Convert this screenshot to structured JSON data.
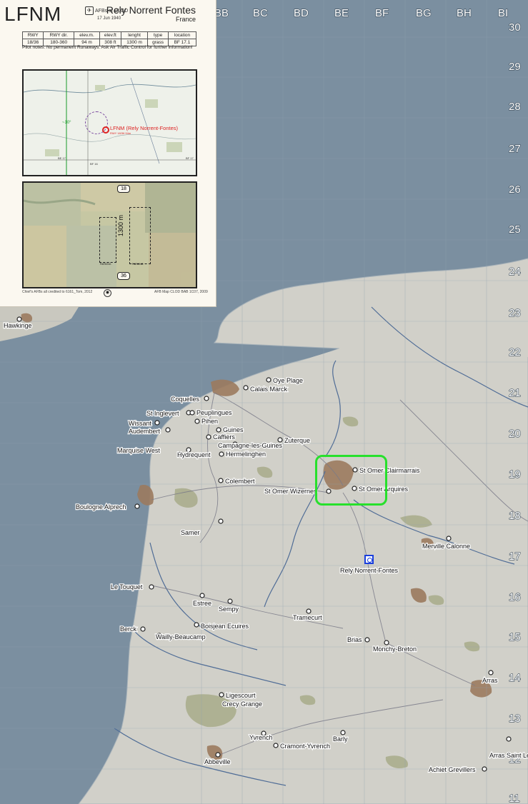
{
  "map": {
    "colors": {
      "sea": "#7b8fa0",
      "land": "#d1d0c9",
      "urban": "#9b7a5e",
      "forest": "#a8ab8a",
      "river": "#4f6c96",
      "road": "#7a7a88",
      "grid": "#8ea0b0",
      "highlight": "#27e02c",
      "marker": "#1a3fdc"
    },
    "columns": [
      "BB",
      "BC",
      "BD",
      "BE",
      "BF",
      "BG",
      "BH",
      "BI"
    ],
    "rows": [
      "30",
      "29",
      "28",
      "27",
      "26",
      "25",
      "24",
      "23",
      "22",
      "21",
      "20",
      "19",
      "18",
      "17",
      "16",
      "15",
      "14",
      "13",
      "12",
      "11"
    ],
    "places": [
      "Hawkinge",
      "Oye Plage",
      "Calais Marck",
      "Coquelles",
      "St Inglevert",
      "Peuplingues",
      "Wissant",
      "Pihen",
      "Audembert",
      "Guines",
      "Caffiers",
      "Campagne-les-Guines",
      "Zuterque",
      "Marquise West",
      "Hydrequent",
      "Hermelinghen",
      "St Omer Clairmarrais",
      "Colembert",
      "St Omer Wizernes",
      "St Omer Arquires",
      "Boulogne Alprech",
      "Samer",
      "Merville Calonne",
      "Rely Norrent-Fontes",
      "Le Touquet",
      "Estree",
      "Sempy",
      "Tramecurt",
      "Berck",
      "Boisjean Ecuires",
      "Wailly-Beaucamp",
      "Brias",
      "Monchy-Breton",
      "Arras",
      "Ligescourt",
      "Crecy Grange",
      "Yvrench",
      "Barly",
      "Cramont-Yvrench",
      "Arras Saint Leger",
      "Abbeville",
      "Achiet Grevillers"
    ],
    "selected_airfield": "Rely Norrent-Fontes"
  },
  "card": {
    "code": "LFNM",
    "org": "AFBs of CLOD",
    "org_icon": "airfield-info-icon",
    "name": "Rely Norrent Fontes",
    "date": "17 Jun 1940",
    "country": "France",
    "table": {
      "headers": [
        "RWY",
        "RWY dir.",
        "elev.m.",
        "elev.ft",
        "lenght",
        "type",
        "location"
      ],
      "row": [
        "18/36",
        "180-360",
        "94 m",
        "308 ft",
        "1300 m",
        "grass",
        "BF 17.1"
      ]
    },
    "pilot_notes": "Pilot notes: No permanent Runaways. Ask Air Traffic Control for further information!",
    "chart": {
      "airfield_label": "LFNM (Rely Norrent-Fontes)",
      "airfield_sub": "RWY 18/36 94m",
      "heading": "~10°",
      "grid_left": "BE 17",
      "grid_right": "BF 17",
      "grid_bottom": "BF 16"
    },
    "runway": {
      "top": "18",
      "bottom": "36",
      "length": "1300 m",
      "parking_label": "PARKING"
    },
    "footer_left": "Chief's AFBs all credited to 6161_Tom, 2012",
    "footer_right": "AFB Map CLOD BAB 1C07, 2009",
    "footer_icon": "compass-icon"
  }
}
